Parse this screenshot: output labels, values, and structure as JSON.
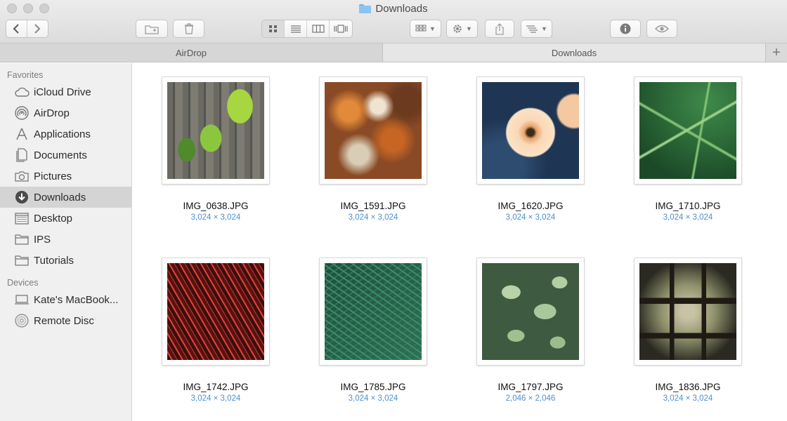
{
  "window": {
    "title": "Downloads"
  },
  "tabs": [
    {
      "label": "AirDrop"
    },
    {
      "label": "Downloads"
    }
  ],
  "sidebar": {
    "sections": [
      {
        "heading": "Favorites",
        "items": [
          {
            "label": "iCloud Drive",
            "icon": "cloud-icon"
          },
          {
            "label": "AirDrop",
            "icon": "airdrop-icon"
          },
          {
            "label": "Applications",
            "icon": "applications-icon"
          },
          {
            "label": "Documents",
            "icon": "documents-icon"
          },
          {
            "label": "Pictures",
            "icon": "camera-icon"
          },
          {
            "label": "Downloads",
            "icon": "download-icon",
            "selected": true
          },
          {
            "label": "Desktop",
            "icon": "desktop-icon"
          },
          {
            "label": "IPS",
            "icon": "folder-icon"
          },
          {
            "label": "Tutorials",
            "icon": "folder-icon"
          }
        ]
      },
      {
        "heading": "Devices",
        "items": [
          {
            "label": "Kate's MacBook...",
            "icon": "laptop-icon"
          },
          {
            "label": "Remote Disc",
            "icon": "disc-icon"
          }
        ]
      }
    ]
  },
  "files": [
    {
      "name": "IMG_0638.JPG",
      "dimensions": "3,024 × 3,024"
    },
    {
      "name": "IMG_1591.JPG",
      "dimensions": "3,024 × 3,024"
    },
    {
      "name": "IMG_1620.JPG",
      "dimensions": "3,024 × 3,024"
    },
    {
      "name": "IMG_1710.JPG",
      "dimensions": "3,024 × 3,024"
    },
    {
      "name": "IMG_1742.JPG",
      "dimensions": "3,024 × 3,024"
    },
    {
      "name": "IMG_1785.JPG",
      "dimensions": "3,024 × 3,024"
    },
    {
      "name": "IMG_1797.JPG",
      "dimensions": "2,046 × 2,046"
    },
    {
      "name": "IMG_1836.JPG",
      "dimensions": "3,024 × 3,024"
    }
  ],
  "colors": {
    "accent": "#4e8fcf",
    "selection": "#d4d4d4"
  }
}
